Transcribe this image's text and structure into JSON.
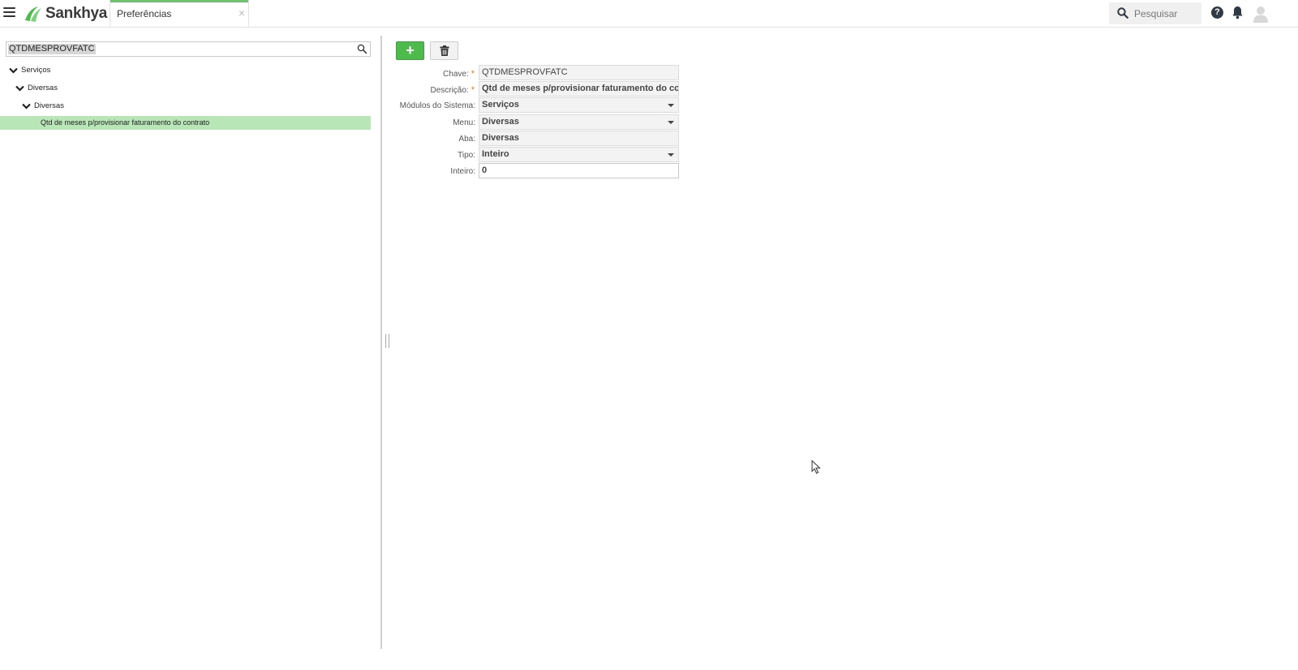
{
  "app": {
    "brand": "Sankhya",
    "accent_color": "#6cc36c",
    "tab": {
      "label": "Preferências",
      "close": "×"
    },
    "search": {
      "placeholder": "Pesquisar"
    },
    "help_glyph": "?"
  },
  "tree": {
    "search_value": "QTDMESPROVFATC",
    "nodes": [
      {
        "label": "Serviços",
        "expanded": true
      },
      {
        "label": "Diversas",
        "expanded": true
      },
      {
        "label": "Diversas",
        "expanded": true
      }
    ],
    "selected_leaf": "Qtd de meses p/provisionar faturamento do contrato",
    "selected_color": "#b8e6b7"
  },
  "toolbar": {
    "add_glyph": "+"
  },
  "form": {
    "required_mark": "*",
    "fields": [
      {
        "label": "Chave:",
        "value": "QTDMESPROVFATC",
        "required": true
      },
      {
        "label": "Descrição:",
        "value": "Qtd de meses p/provisionar faturamento do contrato",
        "required": true
      },
      {
        "label": "Módulos do Sistema:",
        "value": "Serviços",
        "dropdown": true
      },
      {
        "label": "Menu:",
        "value": "Diversas",
        "dropdown": true
      },
      {
        "label": "Aba:",
        "value": "Diversas"
      },
      {
        "label": "Tipo:",
        "value": "Inteiro",
        "dropdown": true
      },
      {
        "label": "Inteiro:",
        "value": "0"
      }
    ]
  }
}
